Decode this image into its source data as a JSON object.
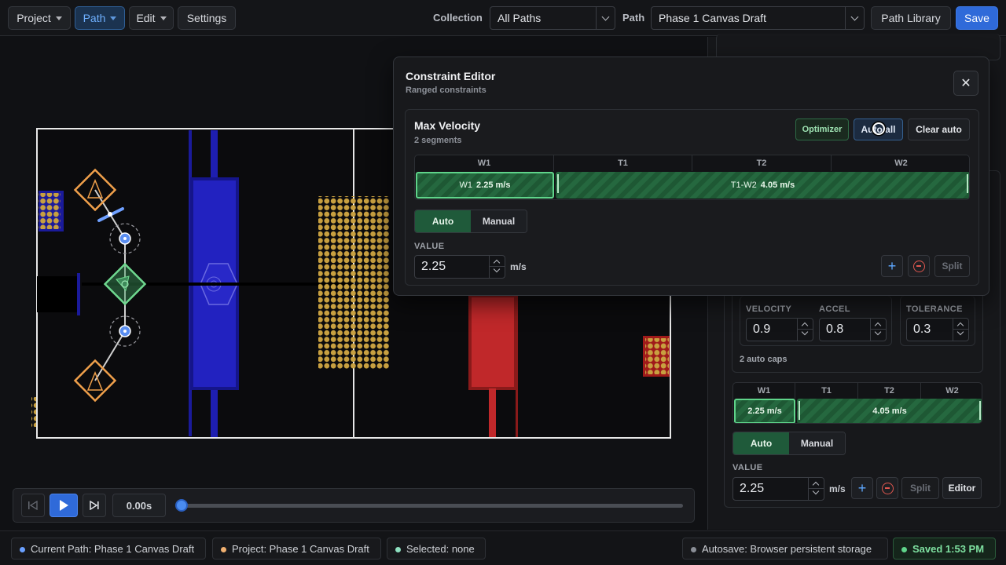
{
  "menu": {
    "project": "Project",
    "path": "Path",
    "edit": "Edit",
    "settings": "Settings"
  },
  "collection": {
    "label": "Collection",
    "value": "All Paths"
  },
  "path_select": {
    "label": "Path",
    "value": "Phase 1 Canvas Draft"
  },
  "actions": {
    "library": "Path Library",
    "save": "Save"
  },
  "modal": {
    "title": "Constraint Editor",
    "subtitle": "Ranged constraints",
    "close_glyph": "✕",
    "constraint": {
      "name": "Max Velocity",
      "segments_label": "2 segments",
      "optimizer": "Optimizer",
      "auto_all": "Auto all",
      "clear_auto": "Clear auto",
      "headers": [
        "W1",
        "T1",
        "T2",
        "W2"
      ],
      "seg1": {
        "name": "W1",
        "value": "2.25 m/s"
      },
      "seg2": {
        "name": "T1-W2",
        "value": "4.05 m/s"
      },
      "mode_auto": "Auto",
      "mode_manual": "Manual",
      "value_label": "VALUE",
      "value": "2.25",
      "unit": "m/s",
      "add_glyph": "+",
      "split": "Split"
    }
  },
  "panel": {
    "fields": [
      {
        "label": "VELOCITY",
        "value": "0.9"
      },
      {
        "label": "ACCEL",
        "value": "0.8"
      },
      {
        "label": "TOLERANCE",
        "value": "0.3"
      }
    ],
    "auto_caps": "2 auto caps",
    "headers": [
      "W1",
      "T1",
      "T2",
      "W2"
    ],
    "seg1_value": "2.25 m/s",
    "seg2_value": "4.05 m/s",
    "mode_auto": "Auto",
    "mode_manual": "Manual",
    "value_label": "VALUE",
    "value": "2.25",
    "unit": "m/s",
    "add_glyph": "+",
    "split": "Split",
    "editor": "Editor"
  },
  "timeline": {
    "time": "0.00s",
    "progress": 0
  },
  "status": {
    "current_path": "Current Path: Phase 1 Canvas Draft",
    "project": "Project: Phase 1 Canvas Draft",
    "selected": "Selected: none",
    "autosave": "Autosave: Browser persistent storage",
    "saved": "Saved 1:53 PM"
  },
  "colors": {
    "accent": "#2f6ad9",
    "segment_green": "#25683f",
    "alliance_blue": "#2020b8",
    "alliance_red": "#c0282a",
    "waypoint_orange": "#f0a04b",
    "ball_gold": "#c8a040"
  }
}
